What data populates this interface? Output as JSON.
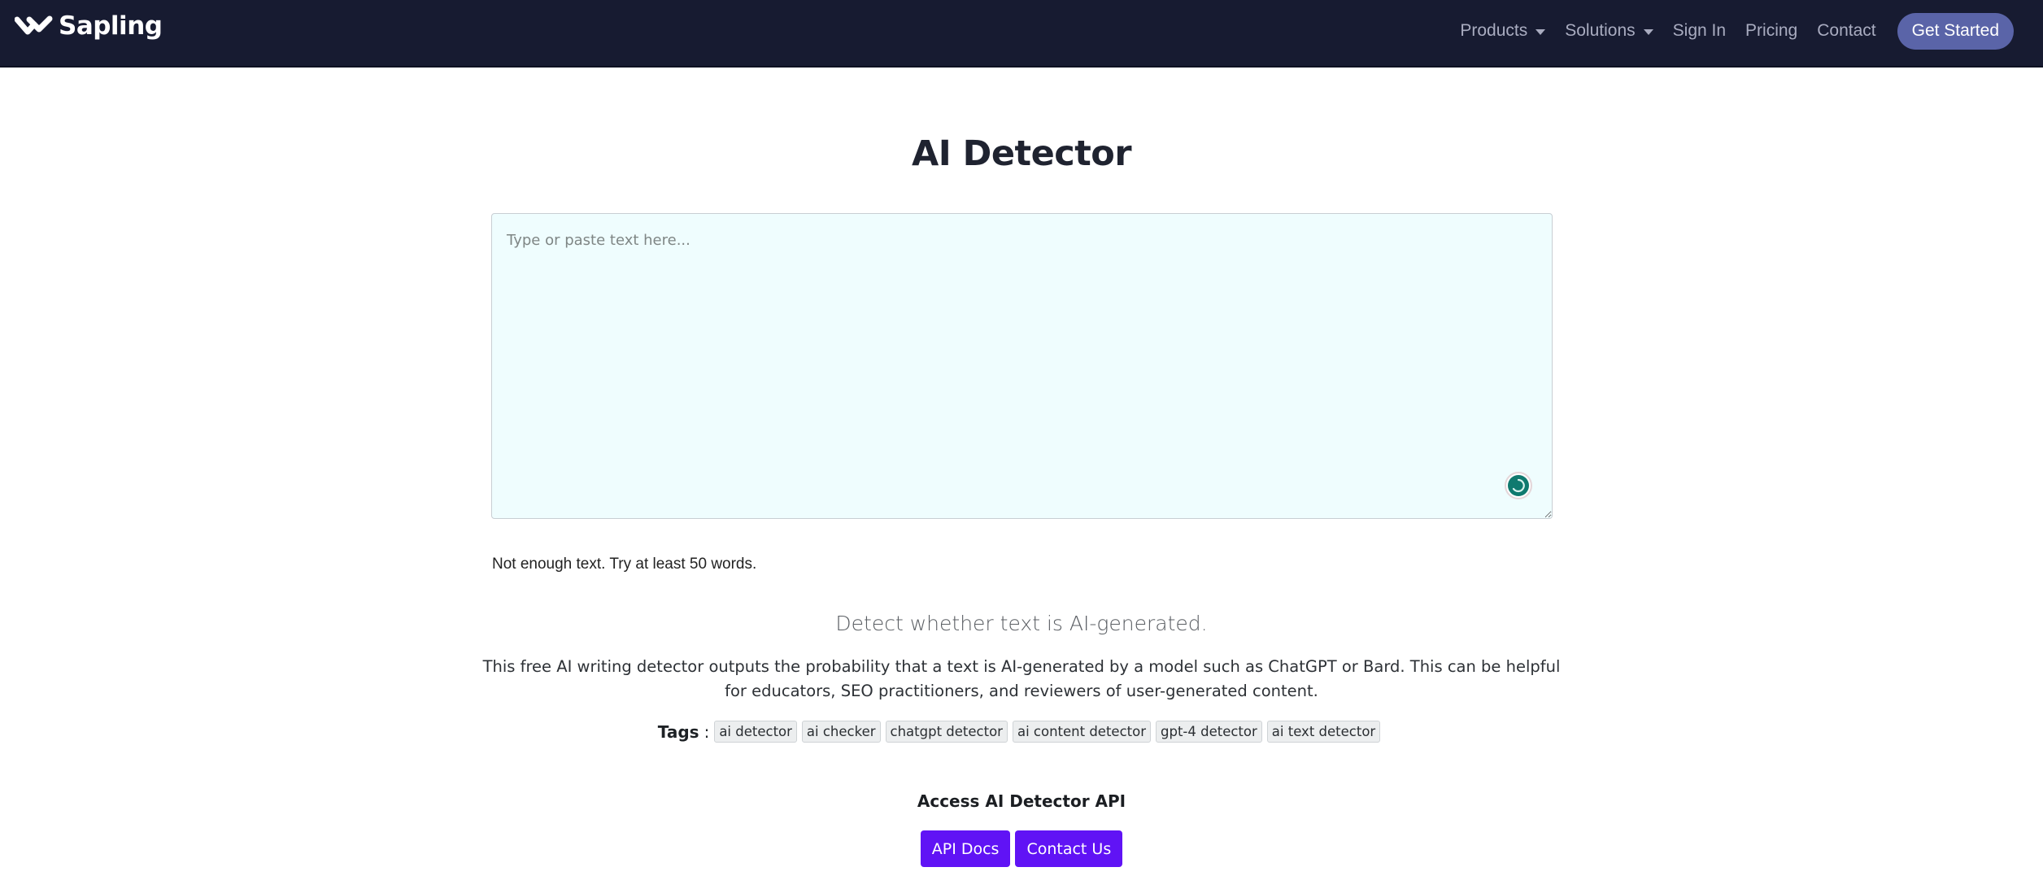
{
  "navbar": {
    "brand": "Sapling",
    "links": [
      {
        "label": "Products",
        "dropdown": true
      },
      {
        "label": "Solutions",
        "dropdown": true
      },
      {
        "label": "Sign In",
        "dropdown": false
      },
      {
        "label": "Pricing",
        "dropdown": false
      },
      {
        "label": "Contact",
        "dropdown": false
      }
    ],
    "cta": "Get Started"
  },
  "main": {
    "title": "AI Detector",
    "editor": {
      "value": "",
      "placeholder": "Type or paste text here...",
      "status_icon": "loading-spinner-icon"
    },
    "notice": "Not enough text. Try at least 50 words.",
    "subtitle": "Detect whether text is AI-generated.",
    "description": "This free AI writing detector outputs the probability that a text is AI-generated by a model such as ChatGPT or Bard. This can be helpful for educators, SEO practitioners, and reviewers of user-generated content.",
    "tags": {
      "label": "Tags",
      "items": [
        "ai detector",
        "ai checker",
        "chatgpt detector",
        "ai content detector",
        "gpt-4 detector",
        "ai text detector"
      ]
    },
    "api": {
      "heading": "Access AI Detector API",
      "buttons": [
        "API Docs",
        "Contact Us"
      ]
    }
  },
  "colors": {
    "navbar_bg": "#171b31",
    "cta_bg": "#5a64a8",
    "editor_bg": "#effdfe",
    "accent_purple": "#6013f5",
    "status_teal": "#0f7a6f"
  }
}
